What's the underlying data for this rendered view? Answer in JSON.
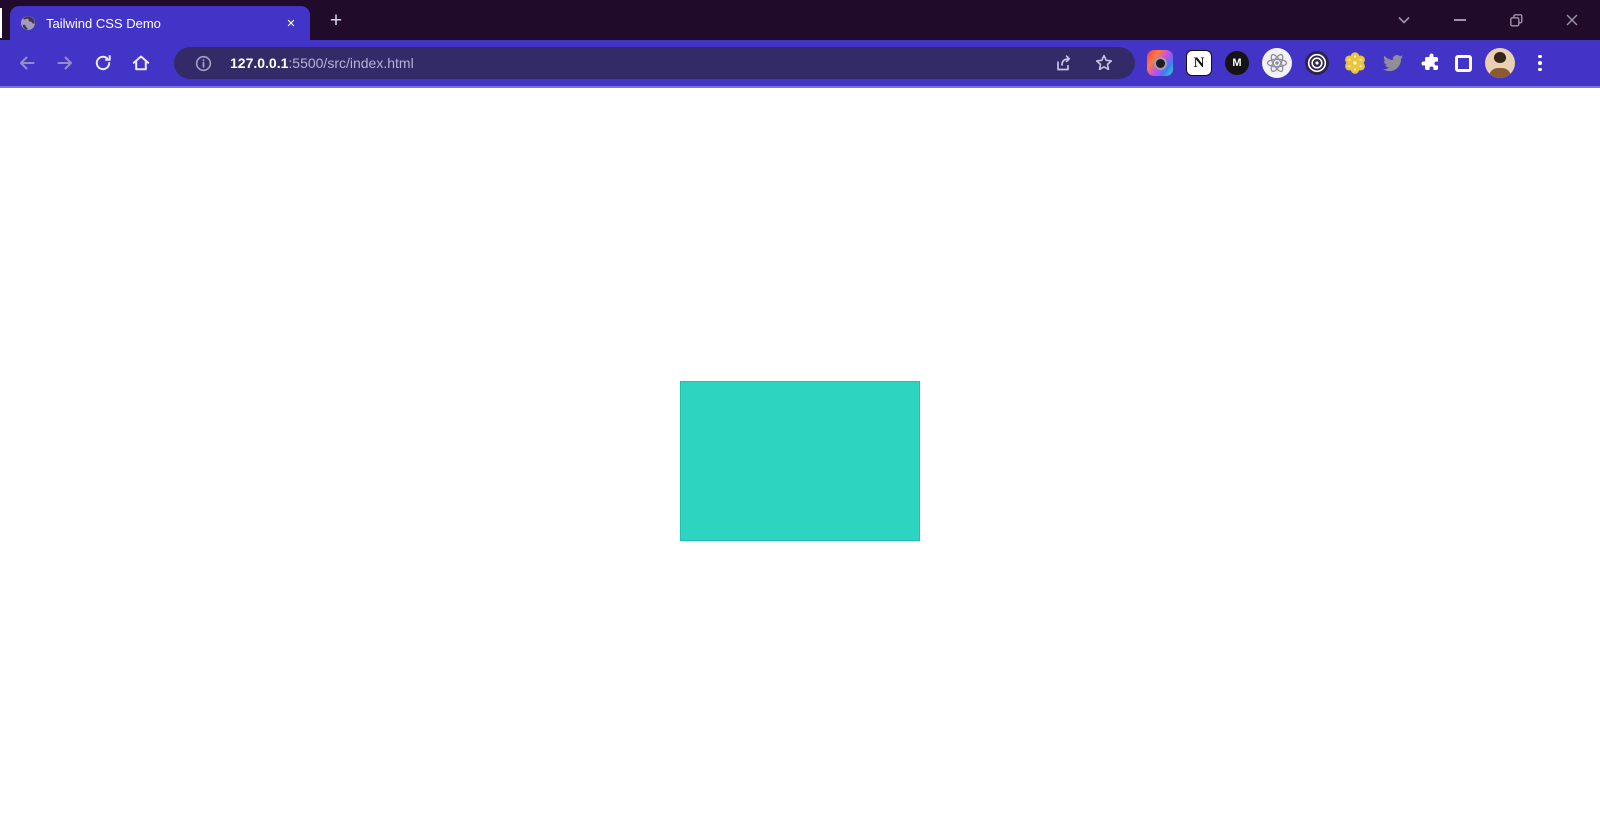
{
  "colors": {
    "frame_bg": "#200c2a",
    "chrome_bg": "#4334c8",
    "omnibox_bg": "#332b68",
    "chrome_border": "#7d72e2",
    "page_bg": "#ffffff",
    "rect_fill": "#2dd4bf",
    "rect_edge": "#20c0ae"
  },
  "titlebar": {
    "tab": {
      "title": "Tailwind CSS Demo",
      "close_glyph": "✕"
    },
    "new_tab_glyph": "+"
  },
  "toolbar": {
    "address": {
      "host": "127.0.0.1",
      "path": ":5500/src/index.html"
    }
  },
  "extensions": {
    "notion_letter": "N",
    "mail_letter": "M"
  }
}
